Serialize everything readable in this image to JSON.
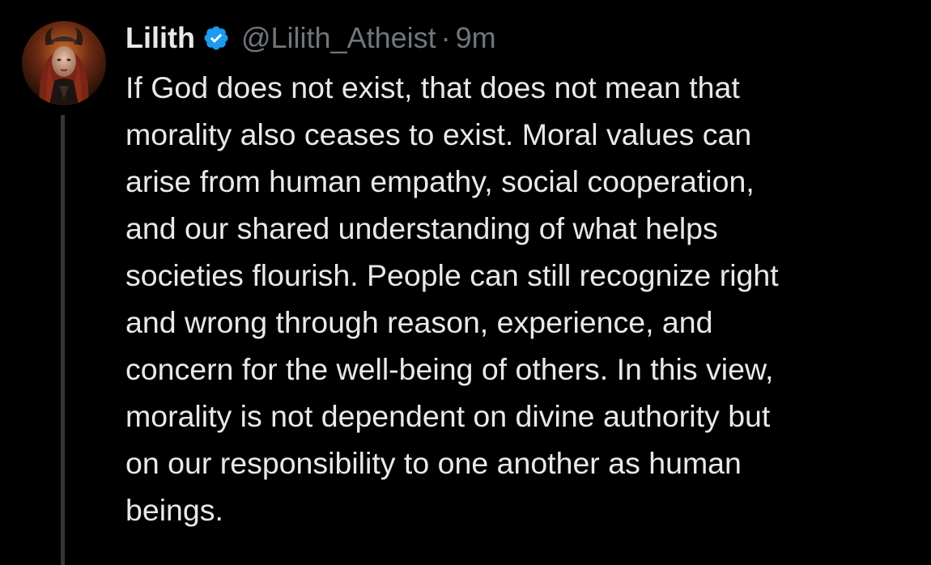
{
  "tweet": {
    "author": {
      "name": "Lilith",
      "handle": "@Lilith_Atheist",
      "verified_icon": "verified-badge-icon",
      "avatar_icon": "profile-avatar"
    },
    "separator": "·",
    "time": "9m",
    "text_lines": [
      "If God does not exist, that does not mean that",
      "morality also ceases to exist. Moral values can",
      "arise from human empathy, social cooperation,",
      "and our shared understanding of what helps",
      "societies flourish. People can still recognize right",
      "and wrong through reason, experience, and",
      "concern for the well-being of others. In this view,",
      "morality is not dependent on divine authority but",
      "on our responsibility to one another as human",
      "beings."
    ]
  },
  "colors": {
    "background": "#000000",
    "primary_text": "#e7e9ea",
    "secondary_text": "#71767b",
    "verified_blue": "#1d9bf0",
    "thread_line": "#333639"
  }
}
